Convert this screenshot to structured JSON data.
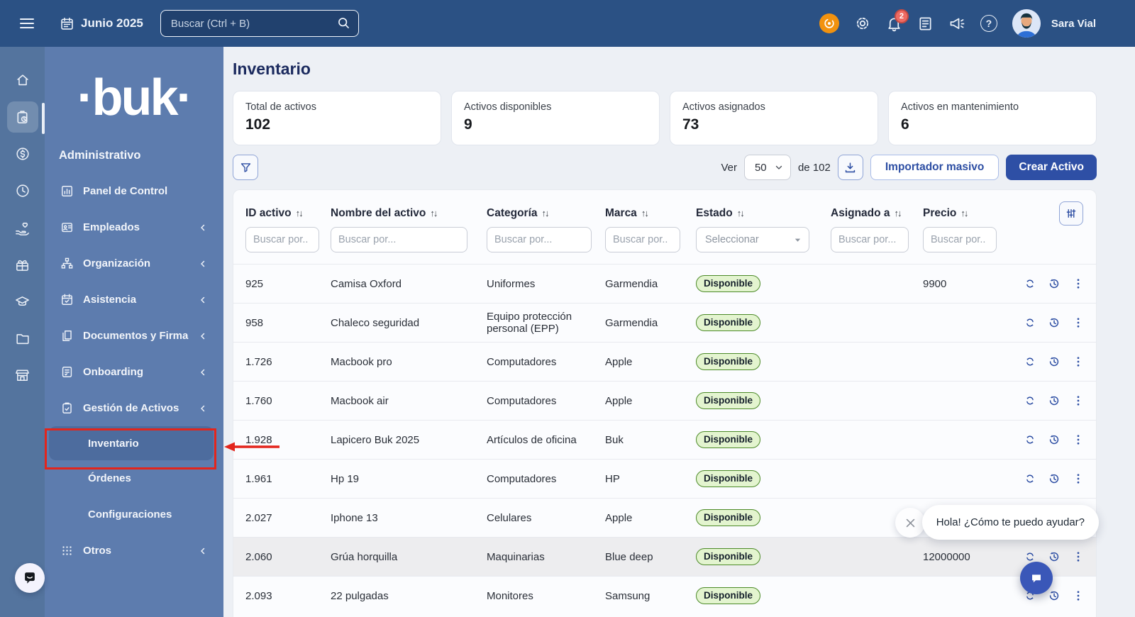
{
  "topbar": {
    "date": "Junio 2025",
    "search_placeholder": "Buscar (Ctrl + B)",
    "notification_count": "2",
    "user_name": "Sara Vial"
  },
  "sidebar": {
    "logo": "·buk·",
    "section": "Administrativo",
    "items": [
      {
        "label": "Panel de Control"
      },
      {
        "label": "Empleados"
      },
      {
        "label": "Organización"
      },
      {
        "label": "Asistencia"
      },
      {
        "label": "Documentos y Firma"
      },
      {
        "label": "Onboarding"
      },
      {
        "label": "Gestión de Activos"
      },
      {
        "label": "Inventario"
      },
      {
        "label": "Órdenes"
      },
      {
        "label": "Configuraciones"
      },
      {
        "label": "Otros"
      }
    ],
    "active_item": "Inventario"
  },
  "main": {
    "title": "Inventario",
    "stats": [
      {
        "label": "Total de activos",
        "value": "102"
      },
      {
        "label": "Activos disponibles",
        "value": "9"
      },
      {
        "label": "Activos asignados",
        "value": "73"
      },
      {
        "label": "Activos en mantenimiento",
        "value": "6"
      }
    ],
    "toolbar": {
      "ver_label": "Ver",
      "page_size": "50",
      "total_label": "de 102",
      "import_label": "Importador masivo",
      "create_label": "Crear Activo"
    },
    "table": {
      "columns": [
        {
          "label": "ID activo",
          "placeholder": "Buscar por.."
        },
        {
          "label": "Nombre del activo",
          "placeholder": "Buscar por..."
        },
        {
          "label": "Categoría",
          "placeholder": "Buscar por..."
        },
        {
          "label": "Marca",
          "placeholder": "Buscar por.."
        },
        {
          "label": "Estado",
          "placeholder": "Seleccionar"
        },
        {
          "label": "Asignado a",
          "placeholder": "Buscar por..."
        },
        {
          "label": "Precio",
          "placeholder": "Buscar por.."
        }
      ],
      "rows": [
        {
          "id": "925",
          "name": "Camisa Oxford",
          "category": "Uniformes",
          "brand": "Garmendia",
          "status": "Disponible",
          "assigned": "",
          "price": "9900"
        },
        {
          "id": "958",
          "name": "Chaleco seguridad",
          "category": "Equipo protección personal (EPP)",
          "brand": "Garmendia",
          "status": "Disponible",
          "assigned": "",
          "price": ""
        },
        {
          "id": "1.726",
          "name": "Macbook pro",
          "category": "Computadores",
          "brand": "Apple",
          "status": "Disponible",
          "assigned": "",
          "price": ""
        },
        {
          "id": "1.760",
          "name": "Macbook air",
          "category": "Computadores",
          "brand": "Apple",
          "status": "Disponible",
          "assigned": "",
          "price": ""
        },
        {
          "id": "1.928",
          "name": "Lapicero Buk 2025",
          "category": "Artículos de oficina",
          "brand": "Buk",
          "status": "Disponible",
          "assigned": "",
          "price": ""
        },
        {
          "id": "1.961",
          "name": "Hp 19",
          "category": "Computadores",
          "brand": "HP",
          "status": "Disponible",
          "assigned": "",
          "price": ""
        },
        {
          "id": "2.027",
          "name": "Iphone 13",
          "category": "Celulares",
          "brand": "Apple",
          "status": "Disponible",
          "assigned": "",
          "price": ""
        },
        {
          "id": "2.060",
          "name": "Grúa horquilla",
          "category": "Maquinarias",
          "brand": "Blue deep",
          "status": "Disponible",
          "assigned": "",
          "price": "12000000",
          "highlighted": true
        },
        {
          "id": "2.093",
          "name": "22 pulgadas",
          "category": "Monitores",
          "brand": "Samsung",
          "status": "Disponible",
          "assigned": "",
          "price": ""
        }
      ]
    }
  },
  "chat": {
    "message": "Hola! ¿Cómo te puedo ayudar?"
  },
  "colors": {
    "topbar": "#2B5184",
    "rail": "#54749E",
    "sidebar": "#5D7CAE",
    "accent": "#2D4EA3",
    "create_button": "#2E4FA5",
    "badge_bg": "#E3F4CF",
    "badge_border": "#4C8A28",
    "annotation_red": "#E3251C",
    "assistant_orange": "#F2920F",
    "notification_red": "#EE6B63"
  }
}
